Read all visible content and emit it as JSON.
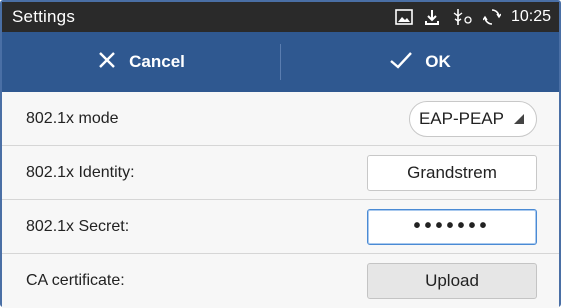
{
  "statusbar": {
    "title": "Settings",
    "time": "10:25",
    "icons": [
      "image-icon",
      "download-icon",
      "usb-icon",
      "sync-icon"
    ]
  },
  "actionbar": {
    "cancel_label": "Cancel",
    "ok_label": "OK",
    "cancel_icon": "close-icon",
    "ok_icon": "check-icon"
  },
  "rows": {
    "mode": {
      "label": "802.1x mode",
      "value": "EAP-PEAP"
    },
    "identity": {
      "label": "802.1x Identity:",
      "value": "Grandstrem"
    },
    "secret": {
      "label": "802.1x Secret:",
      "value": "•••••••"
    },
    "ca": {
      "label": "CA certificate:",
      "button_label": "Upload"
    }
  },
  "colors": {
    "statusbar": "#2a2a2a",
    "actionbar": "#2f5890",
    "focus": "#4a8ad4"
  }
}
